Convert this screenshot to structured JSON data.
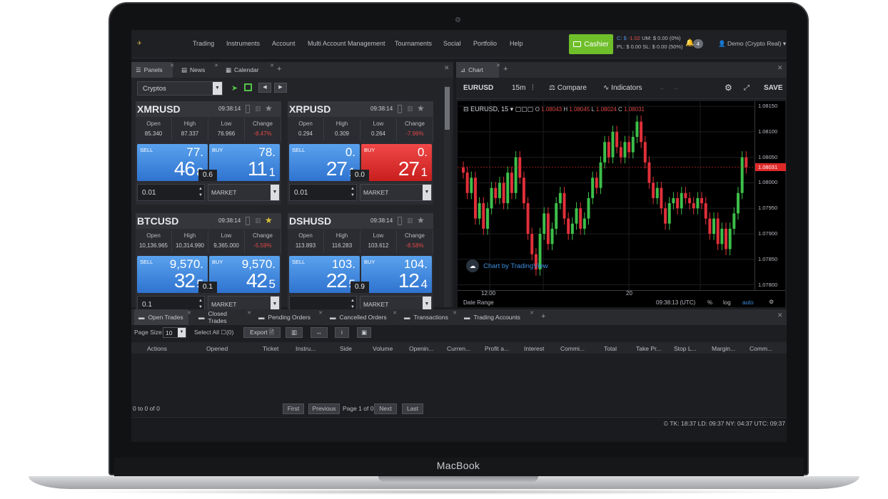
{
  "device": {
    "brand": "MacBook"
  },
  "nav": {
    "items": [
      "Trading",
      "Instruments",
      "Account",
      "Multi Account Management",
      "Tournaments",
      "Social",
      "Portfolio",
      "Help"
    ],
    "cashier_label": "Cashier",
    "balance": {
      "c_label": "C: $",
      "c_value": "-1.02",
      "um": "UM: $ 0.00 (0%)",
      "pl": "PL: $ 0.00",
      "sl": "SL: $ 0.00 (50%)"
    },
    "notifications": "4",
    "user": "Demo (Crypto Real)"
  },
  "left_panel": {
    "tabs": [
      "Panels",
      "News",
      "Calendar"
    ],
    "group_select": "Cryptos",
    "columns": [
      "Open",
      "High",
      "Low",
      "Change"
    ],
    "sell_label": "SELL",
    "buy_label": "BUY",
    "cards": [
      {
        "symbol": "XMRUSD",
        "time": "09:38:14",
        "open": "85.340",
        "high": "87.337",
        "low": "76.966",
        "change": "-8.47%",
        "sell_top": "77.",
        "sell_big": "46",
        "sell_small": "8",
        "buy_top": "78.",
        "buy_big": "11",
        "buy_small": "1",
        "spread": "0.6",
        "qty": "0.01",
        "order_type": "MARKET",
        "buy_color": "blue",
        "fav": false
      },
      {
        "symbol": "XRPUSD",
        "time": "09:38:14",
        "open": "0.294",
        "high": "0.309",
        "low": "0.264",
        "change": "-7.96%",
        "sell_top": "0.",
        "sell_big": "27",
        "sell_small": "1",
        "buy_top": "0.",
        "buy_big": "27",
        "buy_small": "1",
        "spread": "0.0",
        "qty": "0.01",
        "order_type": "MARKET",
        "buy_color": "red",
        "fav": false
      },
      {
        "symbol": "BTCUSD",
        "time": "09:38:14",
        "open": "10,136.965",
        "high": "10,314.990",
        "low": "9,365.000",
        "change": "-5.59%",
        "sell_top": "9,570.",
        "sell_big": "32",
        "sell_small": "5",
        "buy_top": "9,570.",
        "buy_big": "42",
        "buy_small": "5",
        "spread": "0.1",
        "qty": "0.1",
        "order_type": "MARKET",
        "buy_color": "blue",
        "fav": true
      },
      {
        "symbol": "DSHUSD",
        "time": "09:38:14",
        "open": "113.893",
        "high": "116.283",
        "low": "103.612",
        "change": "-8.58%",
        "sell_top": "103.",
        "sell_big": "22",
        "sell_small": "5",
        "buy_top": "104.",
        "buy_big": "12",
        "buy_small": "4",
        "spread": "0.9",
        "qty": "",
        "order_type": "MARKET",
        "buy_color": "blue",
        "fav": false
      }
    ]
  },
  "chart_panel": {
    "tab": "Chart",
    "toolbar": {
      "symbol": "EURUSD",
      "interval": "15m",
      "compare": "Compare",
      "indicators": "Indicators",
      "save": "SAVE"
    },
    "legend": {
      "symbol": "EURUSD, 15",
      "o": "O",
      "o_val": "1.08043",
      "h": "H",
      "h_val": "1.08045",
      "l": "L",
      "l_val": "1.08024",
      "c": "C",
      "c_val": "1.08031"
    },
    "tv_label": "Chart by TradingView",
    "bottom": {
      "date_range": "Date Range",
      "time": "09:38:13 (UTC)",
      "percent": "%",
      "log": "log",
      "auto": "auto"
    },
    "colors": {
      "up": "#3dbf4a",
      "down": "#e0303a",
      "current": "#e02828"
    }
  },
  "chart_data": {
    "type": "candlestick",
    "title": "",
    "x_ticks": [
      "12:00",
      "20"
    ],
    "y_ticks": [
      "1.08150",
      "1.08100",
      "1.08050",
      "1.08000",
      "1.07950",
      "1.07900",
      "1.07850",
      "1.07800"
    ],
    "ylim": [
      1.0777,
      1.0816
    ],
    "current": "1.08031",
    "current_value": 1.08031,
    "closes": [
      1.0802,
      1.0798,
      1.0801,
      1.0793,
      1.0796,
      1.0791,
      1.0795,
      1.0799,
      1.0797,
      1.08,
      1.0796,
      1.0802,
      1.0798,
      1.0805,
      1.0801,
      1.0796,
      1.079,
      1.0786,
      1.0783,
      1.079,
      1.0794,
      1.0788,
      1.0791,
      1.0796,
      1.0798,
      1.0793,
      1.079,
      1.0792,
      1.0795,
      1.0791,
      1.0793,
      1.0797,
      1.0801,
      1.0799,
      1.0804,
      1.0808,
      1.0805,
      1.081,
      1.0807,
      1.0805,
      1.0808,
      1.0806,
      1.0809,
      1.0812,
      1.0808,
      1.0804,
      1.08,
      1.0797,
      1.0799,
      1.0795,
      1.0792,
      1.0796,
      1.0797,
      1.0795,
      1.0798,
      1.0797,
      1.0796,
      1.0795,
      1.0797,
      1.0796,
      1.0793,
      1.079,
      1.0793,
      1.0788,
      1.0791,
      1.0787,
      1.0791,
      1.0794,
      1.0798,
      1.0805,
      1.0803
    ]
  },
  "bottom_panel": {
    "tabs": [
      "Open Trades",
      "Closed Trades",
      "Pending Orders",
      "Cancelled Orders",
      "Transactions",
      "Trading Accounts"
    ],
    "page_size_label": "Page Size:",
    "page_size": "10",
    "select_all": "Select All",
    "select_count": "(0)",
    "export": "Export",
    "columns": [
      "Actions",
      "Opened",
      "Ticket",
      "Instru...",
      "Side",
      "Volume",
      "Openin...",
      "Curren...",
      "Profit a...",
      "Interest",
      "Commi...",
      "Total",
      "Take Pr...",
      "Stop L...",
      "Margin...",
      "Comm..."
    ],
    "count_text": "0 to 0 of 0",
    "pager": {
      "first": "First",
      "previous": "Previous",
      "page": "Page 1 of 0",
      "next": "Next",
      "last": "Last"
    },
    "status": "TK: 18:37 LD: 09:37 NY: 04:37 UTC: 09:37"
  }
}
